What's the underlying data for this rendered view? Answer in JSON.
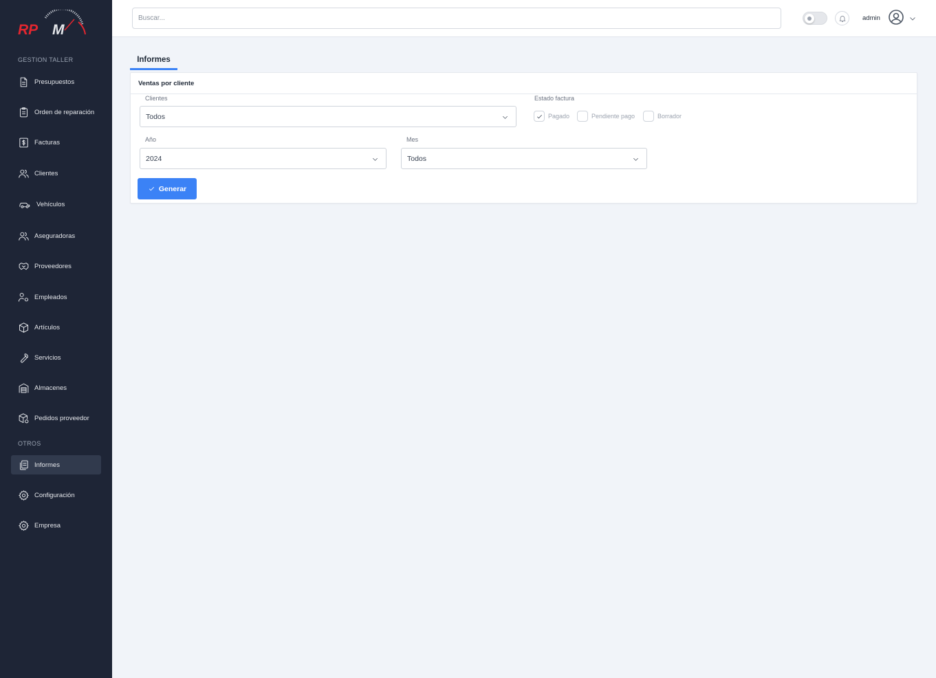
{
  "sidebar": {
    "section_main": "GESTION TALLER",
    "section_other": "OTROS",
    "items": [
      {
        "label": "Presupuestos",
        "icon": "document-icon"
      },
      {
        "label": "Orden de reparación",
        "icon": "clipboard-icon"
      },
      {
        "label": "Facturas",
        "icon": "invoice-dollar-icon"
      },
      {
        "label": "Clientes",
        "icon": "users-icon"
      },
      {
        "label": "Vehículos",
        "icon": "car-icon"
      },
      {
        "label": "Aseguradoras",
        "icon": "users-icon"
      },
      {
        "label": "Proveedores",
        "icon": "handshake-icon"
      },
      {
        "label": "Empleados",
        "icon": "user-gear-icon"
      },
      {
        "label": "Artículos",
        "icon": "box-icon"
      },
      {
        "label": "Servicios",
        "icon": "wrench-icon"
      },
      {
        "label": "Almacenes",
        "icon": "warehouse-icon"
      },
      {
        "label": "Pedidos proveedor",
        "icon": "package-icon"
      }
    ],
    "other_items": [
      {
        "label": "Informes",
        "icon": "documents-icon",
        "active": true
      },
      {
        "label": "Configuración",
        "icon": "gear-icon"
      },
      {
        "label": "Empresa",
        "icon": "gear-icon"
      }
    ]
  },
  "header": {
    "search_placeholder": "Buscar...",
    "user_name": "admin"
  },
  "tab": {
    "label": "Informes"
  },
  "report": {
    "title": "Ventas por cliente",
    "clientes_label": "Clientes",
    "clientes_value": "Todos",
    "estado_label": "Estado factura",
    "estados": [
      {
        "label": "Pagado",
        "checked": true
      },
      {
        "label": "Pendiente pago",
        "checked": false
      },
      {
        "label": "Borrador",
        "checked": false
      }
    ],
    "anio_label": "Año",
    "anio_value": "2024",
    "mes_label": "Mes",
    "mes_value": "Todos",
    "generar_label": "Generar"
  },
  "colors": {
    "sidebar_bg": "#1e2536",
    "accent": "#3b82f6",
    "logo_red": "#e3262f"
  }
}
